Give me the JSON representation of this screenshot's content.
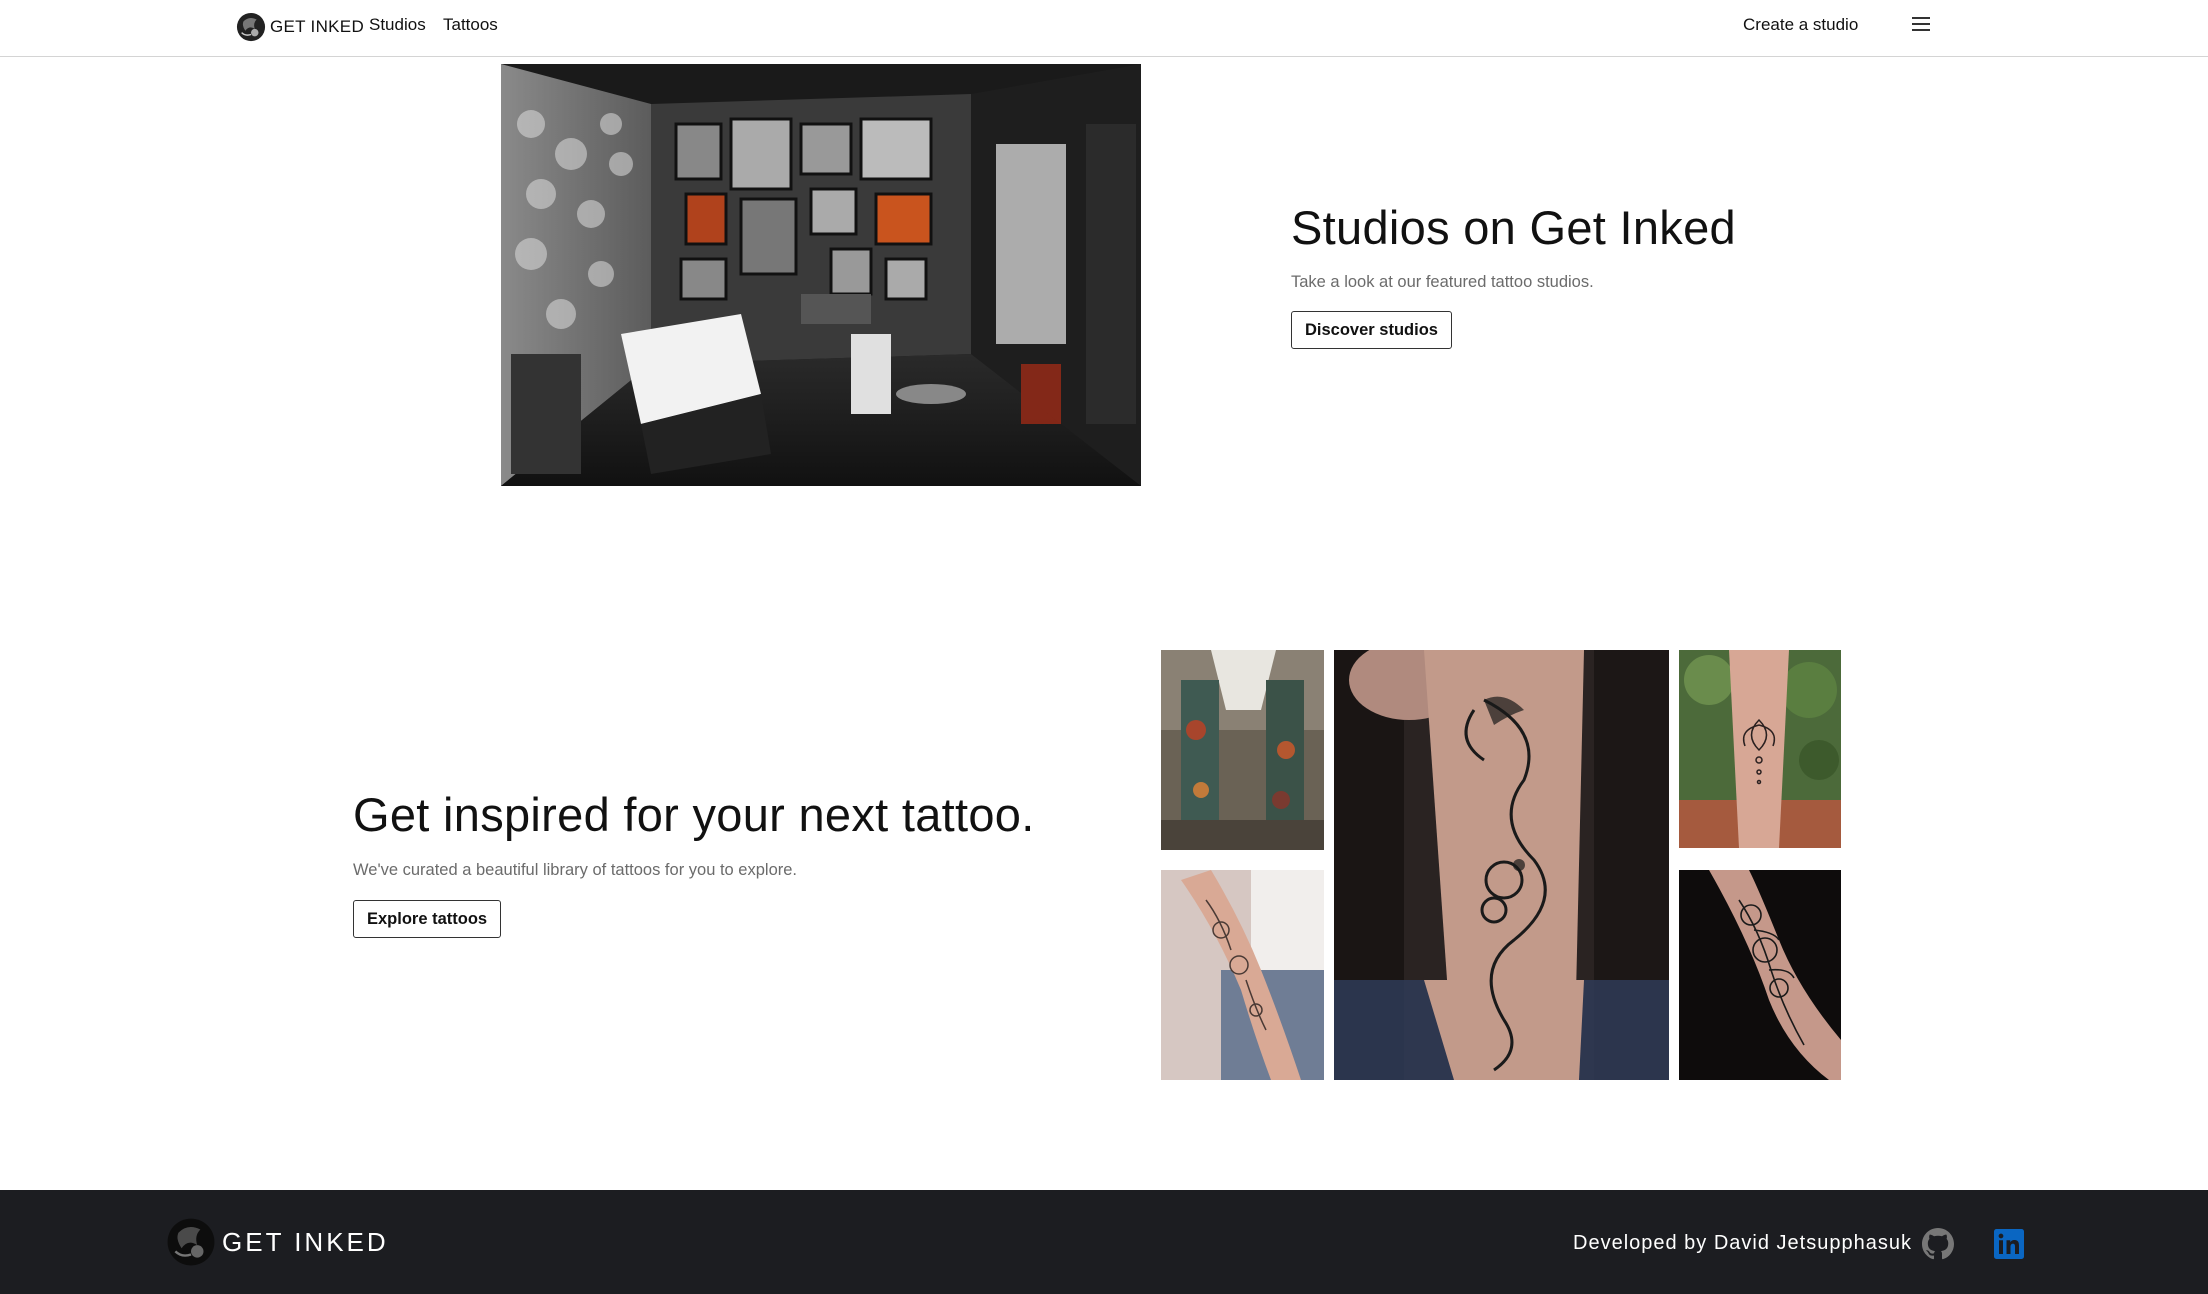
{
  "navbar": {
    "brand": "GET INKED",
    "links": [
      "Studios",
      "Tattoos"
    ],
    "create_studio": "Create a studio",
    "menu_icon": "hamburger-menu-icon"
  },
  "studios_section": {
    "title": "Studios on Get Inked",
    "subtitle": "Take a look at our featured tattoo studios.",
    "button": "Discover studios",
    "image": "tattoo-studio-interior"
  },
  "tattoos_section": {
    "title": "Get inspired for your next tattoo.",
    "subtitle": "We've curated a beautiful library of tattoos for you to explore.",
    "button": "Explore tattoos",
    "images": [
      "color-sleeve-tattoos",
      "floral-forearm-tattoo",
      "dragon-forearm-tattoo",
      "lotus-mandala-tattoo",
      "rose-forearm-tattoo"
    ]
  },
  "footer": {
    "brand": "GET INKED",
    "developer": "Developed by David Jetsupphasuk",
    "icons": [
      "github-icon",
      "linkedin-icon"
    ],
    "colors": {
      "background": "#1c1d21",
      "github": "#777777",
      "linkedin": "#0a66c2"
    }
  }
}
